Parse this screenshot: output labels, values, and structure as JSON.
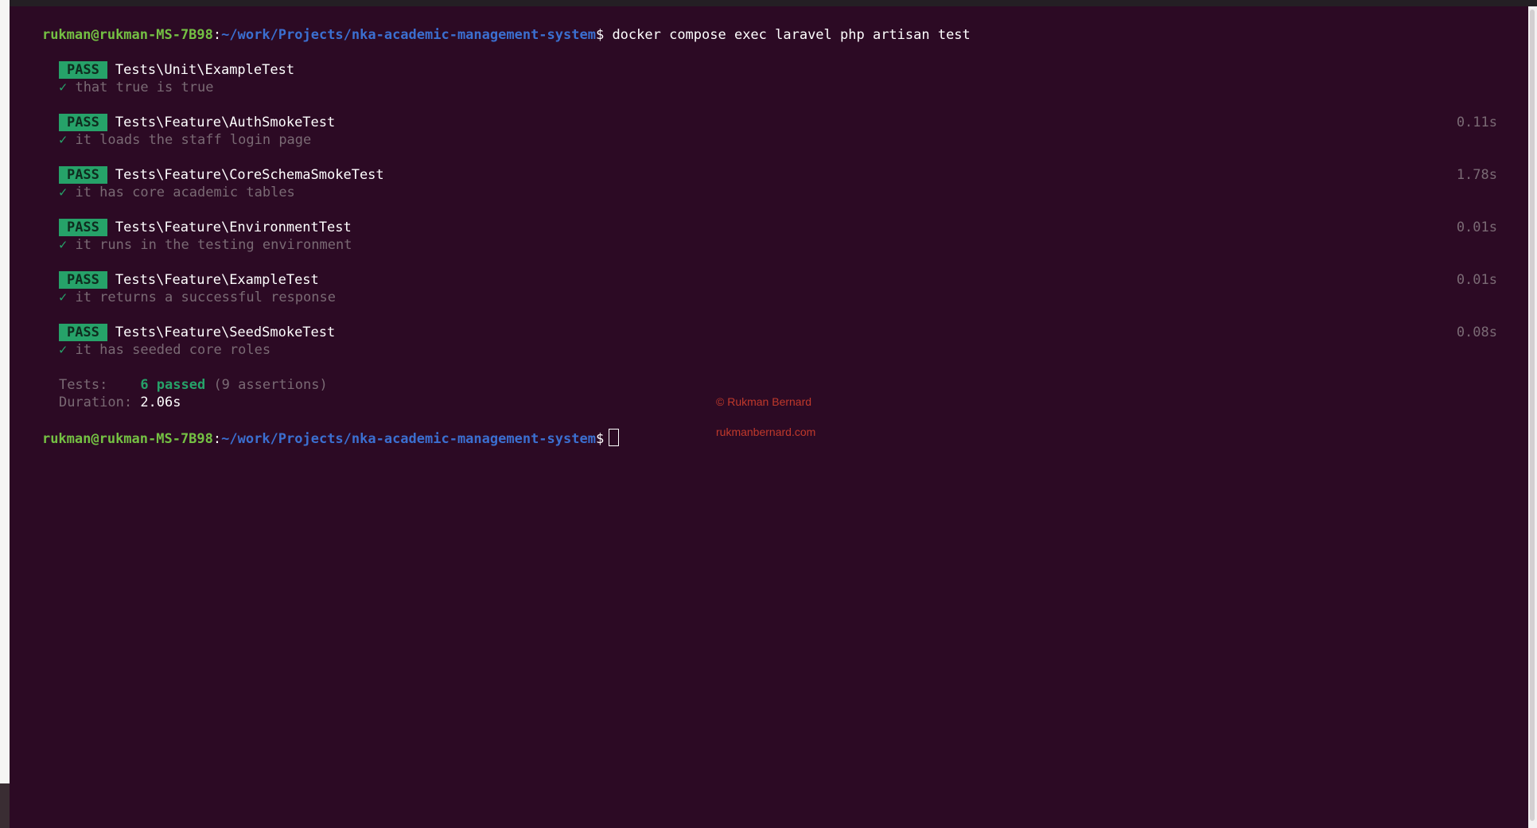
{
  "prompt": {
    "user_host": "rukman@rukman-MS-7B98",
    "colon": ":",
    "path": "~/work/Projects/nka-academic-management-system",
    "dollar": "$"
  },
  "command": " docker compose exec laravel php artisan test",
  "tests": [
    {
      "status": "PASS",
      "name": "Tests\\Unit\\ExampleTest",
      "check": "✓",
      "description": "that true is true",
      "time": ""
    },
    {
      "status": "PASS",
      "name": "Tests\\Feature\\AuthSmokeTest",
      "check": "✓",
      "description": "it loads the staff login page",
      "time": "0.11s"
    },
    {
      "status": "PASS",
      "name": "Tests\\Feature\\CoreSchemaSmokeTest",
      "check": "✓",
      "description": "it has core academic tables",
      "time": "1.78s"
    },
    {
      "status": "PASS",
      "name": "Tests\\Feature\\EnvironmentTest",
      "check": "✓",
      "description": "it runs in the testing environment",
      "time": "0.01s"
    },
    {
      "status": "PASS",
      "name": "Tests\\Feature\\ExampleTest",
      "check": "✓",
      "description": "it returns a successful response",
      "time": "0.01s"
    },
    {
      "status": "PASS",
      "name": "Tests\\Feature\\SeedSmokeTest",
      "check": "✓",
      "description": "it has seeded core roles",
      "time": "0.08s"
    }
  ],
  "summary": {
    "tests_label": "Tests:    ",
    "passed": "6 passed",
    "assertions": " (9 assertions)",
    "duration_label": "Duration: ",
    "duration_value": "2.06s"
  },
  "watermark": {
    "copyright": "© Rukman Bernard",
    "site": "rukmanbernard.com"
  },
  "colors": {
    "background": "#2c0a24",
    "pass_badge": "#26a269",
    "path": "#3b6fd0",
    "user_host": "#74c043",
    "muted": "#7a6a74",
    "watermark": "#c0392b"
  }
}
